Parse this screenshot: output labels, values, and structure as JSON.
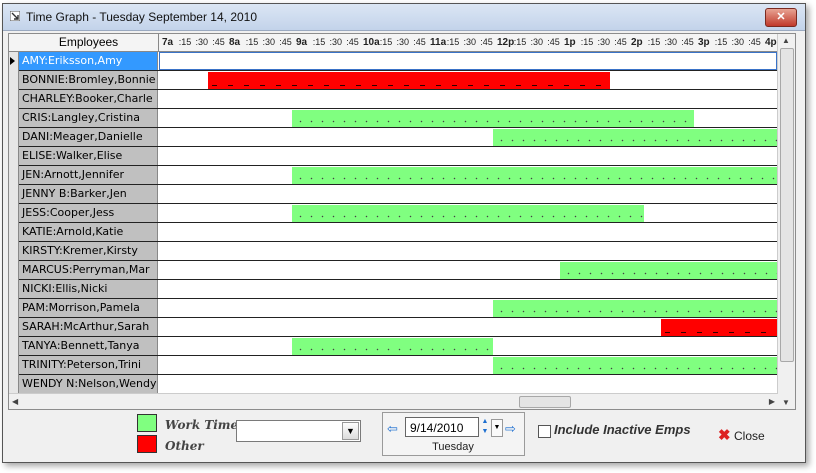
{
  "window": {
    "title": "Time Graph - Tuesday September 14, 2010",
    "close_glyph": "✕"
  },
  "grid": {
    "employees_header": "Employees",
    "time_ticks": [
      {
        "label": "7a",
        "hour": true
      },
      {
        "label": ":15",
        "hour": false
      },
      {
        "label": ":30",
        "hour": false
      },
      {
        "label": ":45",
        "hour": false
      },
      {
        "label": "8a",
        "hour": true
      },
      {
        "label": ":15",
        "hour": false
      },
      {
        "label": ":30",
        "hour": false
      },
      {
        "label": ":45",
        "hour": false
      },
      {
        "label": "9a",
        "hour": true
      },
      {
        "label": ":15",
        "hour": false
      },
      {
        "label": ":30",
        "hour": false
      },
      {
        "label": ":45",
        "hour": false
      },
      {
        "label": "10a",
        "hour": true
      },
      {
        "label": ":15",
        "hour": false
      },
      {
        "label": ":30",
        "hour": false
      },
      {
        "label": ":45",
        "hour": false
      },
      {
        "label": "11a",
        "hour": true
      },
      {
        "label": ":15",
        "hour": false
      },
      {
        "label": ":30",
        "hour": false
      },
      {
        "label": ":45",
        "hour": false
      },
      {
        "label": "12p",
        "hour": true
      },
      {
        "label": ":15",
        "hour": false
      },
      {
        "label": ":30",
        "hour": false
      },
      {
        "label": ":45",
        "hour": false
      },
      {
        "label": "1p",
        "hour": true
      },
      {
        "label": ":15",
        "hour": false
      },
      {
        "label": ":30",
        "hour": false
      },
      {
        "label": ":45",
        "hour": false
      },
      {
        "label": "2p",
        "hour": true
      },
      {
        "label": ":15",
        "hour": false
      },
      {
        "label": ":30",
        "hour": false
      },
      {
        "label": ":45",
        "hour": false
      },
      {
        "label": "3p",
        "hour": true
      },
      {
        "label": ":15",
        "hour": false
      },
      {
        "label": ":30",
        "hour": false
      },
      {
        "label": ":45",
        "hour": false
      },
      {
        "label": "4p",
        "hour": true
      }
    ],
    "rows": [
      {
        "name": "AMY:Eriksson,Amy",
        "selected": true,
        "bars": []
      },
      {
        "name": "BONNIE:Bromley,Bonnie",
        "bars": [
          {
            "type": "other",
            "start": "7:45",
            "end": "1:45"
          }
        ]
      },
      {
        "name": "CHARLEY:Booker,Charle",
        "bars": []
      },
      {
        "name": "CRIS:Langley,Cristina",
        "bars": [
          {
            "type": "work",
            "start": "9:00",
            "end": "3:00"
          }
        ]
      },
      {
        "name": "DANI:Meager,Danielle",
        "bars": [
          {
            "type": "work",
            "start": "12:00",
            "end": "4:15"
          }
        ]
      },
      {
        "name": "ELISE:Walker,Elise",
        "bars": []
      },
      {
        "name": "JEN:Arnott,Jennifer",
        "bars": [
          {
            "type": "work",
            "start": "9:00",
            "end": "4:15"
          }
        ]
      },
      {
        "name": "JENNY B:Barker,Jen",
        "bars": []
      },
      {
        "name": "JESS:Cooper,Jess",
        "bars": [
          {
            "type": "work",
            "start": "9:00",
            "end": "2:15"
          }
        ]
      },
      {
        "name": "KATIE:Arnold,Katie",
        "bars": []
      },
      {
        "name": "KIRSTY:Kremer,Kirsty",
        "bars": []
      },
      {
        "name": "MARCUS:Perryman,Mar",
        "bars": [
          {
            "type": "work",
            "start": "1:00",
            "end": "4:15"
          }
        ]
      },
      {
        "name": "NICKI:Ellis,Nicki",
        "bars": []
      },
      {
        "name": "PAM:Morrison,Pamela",
        "bars": [
          {
            "type": "work",
            "start": "12:00",
            "end": "4:15"
          }
        ]
      },
      {
        "name": "SARAH:McArthur,Sarah",
        "bars": [
          {
            "type": "other",
            "start": "2:30",
            "end": "4:15"
          }
        ]
      },
      {
        "name": "TANYA:Bennett,Tanya",
        "bars": [
          {
            "type": "work",
            "start": "9:00",
            "end": "12:00"
          }
        ]
      },
      {
        "name": "TRINITY:Peterson,Trini",
        "bars": [
          {
            "type": "work",
            "start": "12:00",
            "end": "4:15"
          }
        ]
      },
      {
        "name": "WENDY N:Nelson,Wendy",
        "bars": []
      }
    ]
  },
  "legend": {
    "work_label": "Work Time",
    "other_label": "Other",
    "work_color": "#80ff80",
    "other_color": "#ff0000"
  },
  "filter": {
    "value": ""
  },
  "date": {
    "value": "9/14/2010",
    "day": "Tuesday"
  },
  "options": {
    "include_inactive_label": "Include Inactive Emps",
    "include_inactive_checked": false
  },
  "actions": {
    "close_label": "Close"
  }
}
